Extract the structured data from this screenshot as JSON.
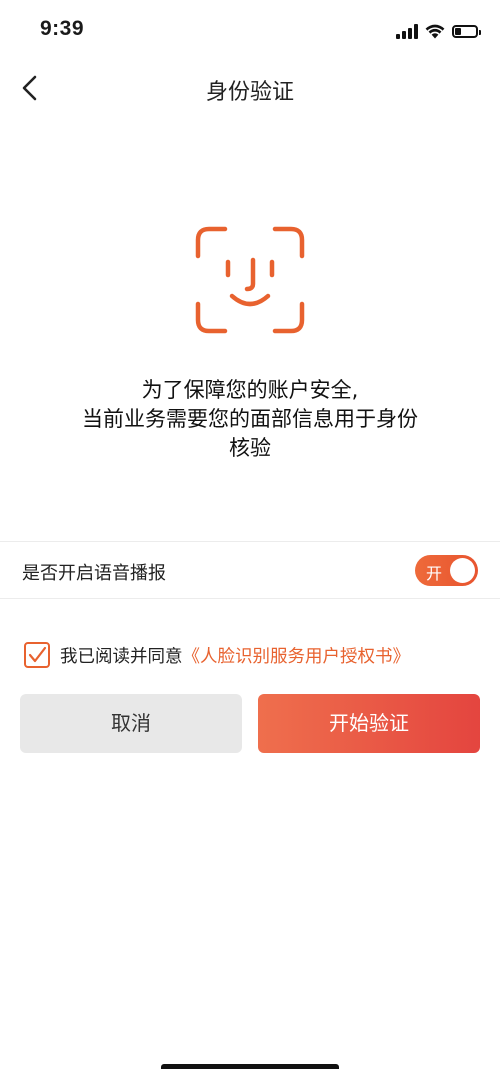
{
  "status_bar": {
    "time": "9:39",
    "battery_level": 0.3,
    "icons": [
      "signal-icon",
      "wifi-icon",
      "battery-icon"
    ]
  },
  "nav": {
    "title": "身份验证",
    "back_icon": "chevron-left-icon"
  },
  "face_icon": "face-id-icon",
  "description": {
    "line1": "为了保障您的账户安全,",
    "line2": "当前业务需要您的面部信息用于身份",
    "line3": "核验"
  },
  "voice": {
    "label": "是否开启语音播报",
    "toggle_text": "开",
    "enabled": true
  },
  "agreement": {
    "checked": true,
    "text": "我已阅读并同意",
    "link": "《人脸识别服务用户授权书》"
  },
  "buttons": {
    "cancel": "取消",
    "start": "开始验证"
  },
  "colors": {
    "accent": "#e8622f",
    "button_gradient_start": "#ef6f4d",
    "button_gradient_end": "#e4453f",
    "cancel_bg": "#e8e8e8"
  }
}
